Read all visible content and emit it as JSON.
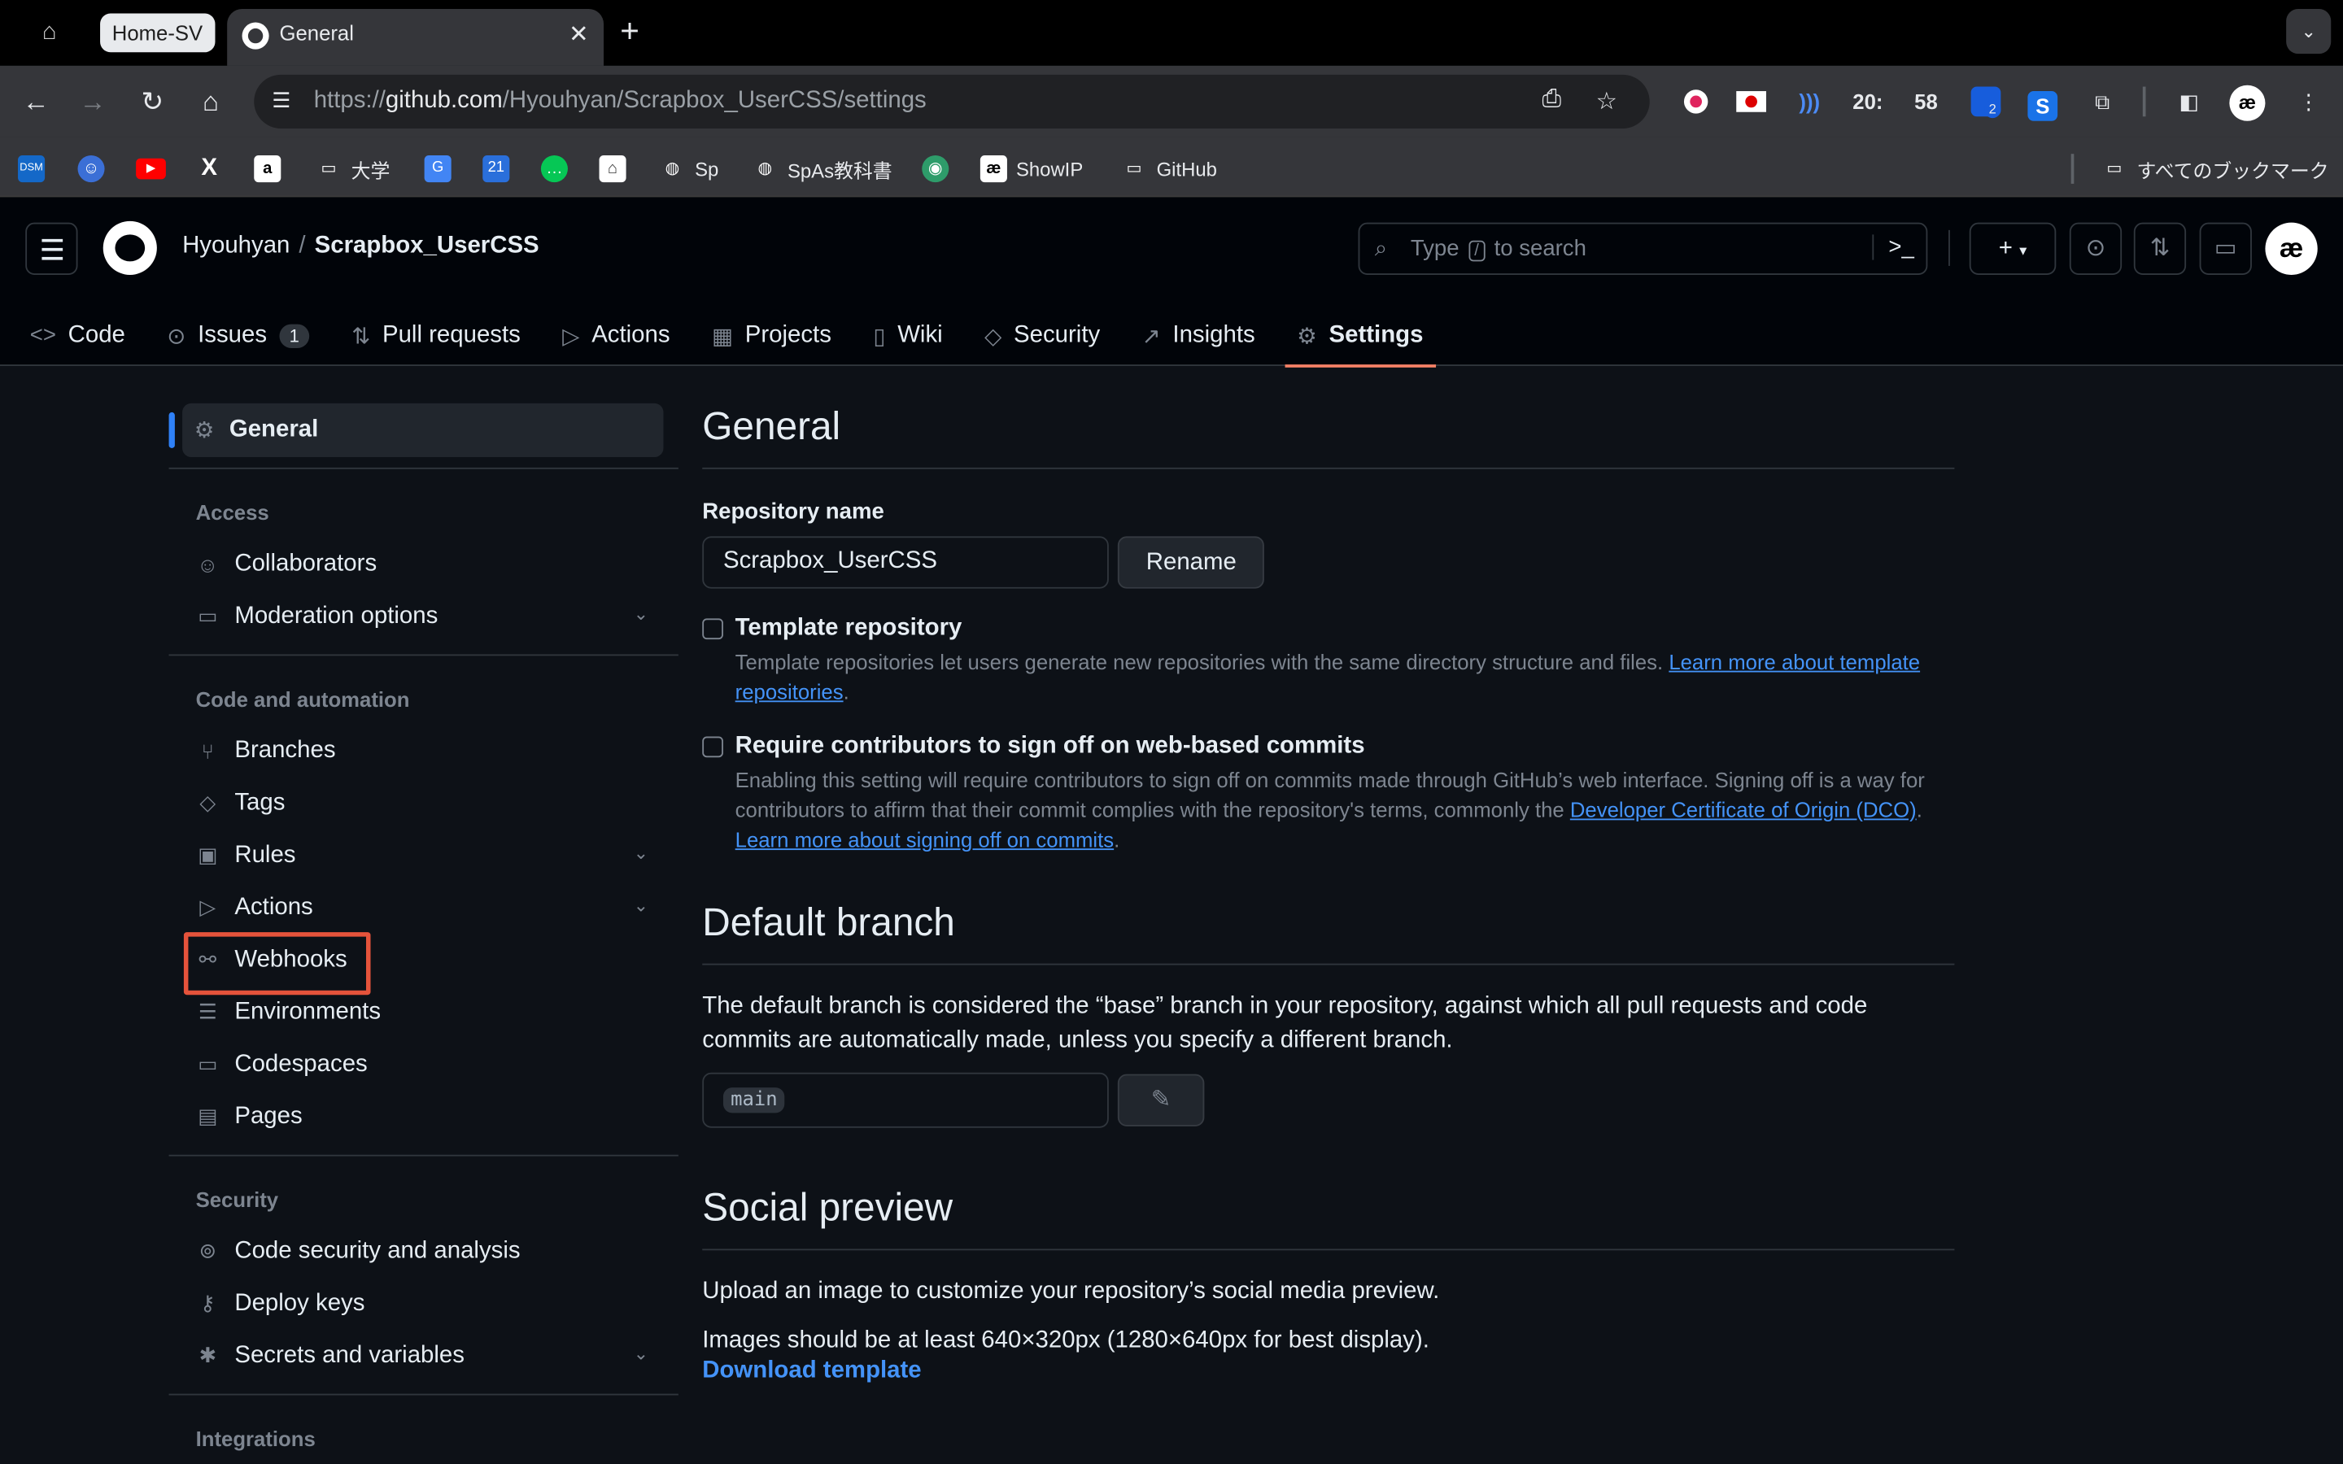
{
  "browser": {
    "group_tab": "Home-SV",
    "active_tab_title": "General",
    "url_prefix": "https://",
    "url_host": "github.com",
    "url_path": "/Hyouhyan/Scrapbox_UserCSS/settings",
    "time_hour": "20:",
    "time_min": "58",
    "ext_badge": "2",
    "bookmarks": [
      {
        "label": "大学",
        "icon": "folder-icon"
      },
      {
        "label": "Sp",
        "icon": "globe-icon"
      },
      {
        "label": "SpAs教科書",
        "icon": "globe-icon"
      },
      {
        "label": "ShowIP",
        "icon": "showip-icon"
      },
      {
        "label": "GitHub",
        "icon": "folder-icon"
      }
    ],
    "all_bookmarks": "すべてのブックマーク"
  },
  "header": {
    "owner": "Hyouhyan",
    "separator": "/",
    "repo": "Scrapbox_UserCSS",
    "search_before": "Type",
    "search_key": "/",
    "search_after": "to search"
  },
  "repo_nav": [
    {
      "label": "Code",
      "icon": "code-icon"
    },
    {
      "label": "Issues",
      "icon": "issue-icon",
      "count": "1"
    },
    {
      "label": "Pull requests",
      "icon": "pull-request-icon"
    },
    {
      "label": "Actions",
      "icon": "play-icon"
    },
    {
      "label": "Projects",
      "icon": "table-icon"
    },
    {
      "label": "Wiki",
      "icon": "book-icon"
    },
    {
      "label": "Security",
      "icon": "shield-icon"
    },
    {
      "label": "Insights",
      "icon": "graph-icon"
    },
    {
      "label": "Settings",
      "icon": "gear-icon",
      "selected": true
    }
  ],
  "sidebar": {
    "general": "General",
    "access_heading": "Access",
    "collaborators": "Collaborators",
    "moderation": "Moderation options",
    "code_heading": "Code and automation",
    "branches": "Branches",
    "tags": "Tags",
    "rules": "Rules",
    "actions": "Actions",
    "webhooks": "Webhooks",
    "environments": "Environments",
    "codespaces": "Codespaces",
    "pages": "Pages",
    "security_heading": "Security",
    "code_security": "Code security and analysis",
    "deploy_keys": "Deploy keys",
    "secrets": "Secrets and variables",
    "integrations_heading": "Integrations"
  },
  "main": {
    "title": "General",
    "repo_name_label": "Repository name",
    "repo_name_value": "Scrapbox_UserCSS",
    "rename_button": "Rename",
    "template_title": "Template repository",
    "template_desc": "Template repositories let users generate new repositories with the same directory structure and files.",
    "template_link": "Learn more about template repositories",
    "signoff_title": "Require contributors to sign off on web-based commits",
    "signoff_desc": "Enabling this setting will require contributors to sign off on commits made through GitHub’s web interface. Signing off is a way for contributors to affirm that their commit complies with the repository's terms, commonly the",
    "signoff_dco_link": "Developer Certificate of Origin (DCO)",
    "signoff_learn_link": "Learn more about signing off on commits",
    "default_branch_title": "Default branch",
    "default_branch_desc": "The default branch is considered the “base” branch in your repository, against which all pull requests and code commits are automatically made, unless you specify a different branch.",
    "default_branch_value": "main",
    "social_title": "Social preview",
    "social_desc": "Upload an image to customize your repository’s social media preview.",
    "social_size": "Images should be at least 640×320px (1280×640px for best display).",
    "download_template": "Download template"
  }
}
